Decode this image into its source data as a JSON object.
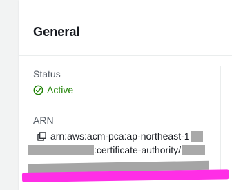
{
  "card": {
    "title": "General"
  },
  "status": {
    "label": "Status",
    "value": "Active",
    "color": "#1d8102",
    "icon": "check-circle-icon"
  },
  "arn": {
    "label": "ARN",
    "prefix": "arn:aws:acm-pca:ap-northeast-1",
    "mid": ":certificate-authority/",
    "copy_icon": "copy-icon"
  },
  "colors": {
    "highlight": "#ff2ee6",
    "redaction": "#a9a9a9"
  }
}
